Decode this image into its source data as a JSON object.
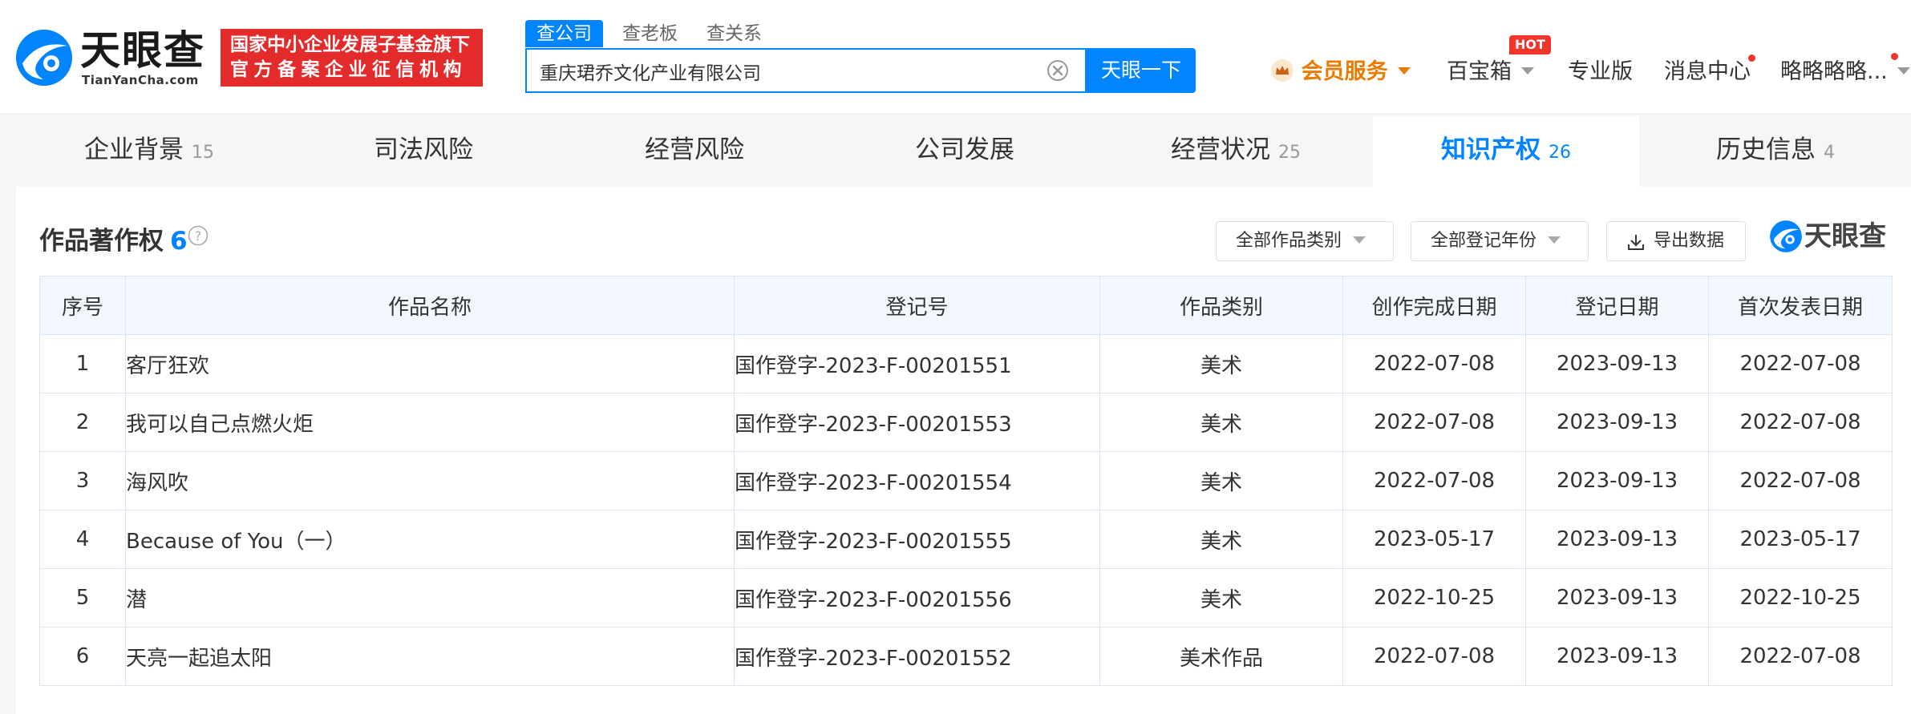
{
  "header": {
    "logo_text": "天眼查",
    "logo_sub": "TianYanCha.com",
    "fund_badge_line1": "国家中小企业发展子基金旗下",
    "fund_badge_line2": "官方备案企业征信机构",
    "search_tabs": [
      "查公司",
      "查老板",
      "查关系"
    ],
    "search_value": "重庆珺乔文化产业有限公司",
    "search_button": "天眼一下",
    "nav": {
      "vip": "会员服务",
      "treasure": "百宝箱",
      "hot_badge": "HOT",
      "pro": "专业版",
      "messages": "消息中心",
      "user": "略略略略..."
    }
  },
  "tabs": [
    {
      "label": "企业背景",
      "count": "15"
    },
    {
      "label": "司法风险",
      "count": ""
    },
    {
      "label": "经营风险",
      "count": ""
    },
    {
      "label": "公司发展",
      "count": ""
    },
    {
      "label": "经营状况",
      "count": "25"
    },
    {
      "label": "知识产权",
      "count": "26"
    },
    {
      "label": "历史信息",
      "count": "4"
    }
  ],
  "section": {
    "title": "作品著作权",
    "count": "6",
    "filters": [
      "全部作品类别",
      "全部登记年份"
    ],
    "export": "导出数据",
    "watermark_text": "天眼查"
  },
  "table": {
    "headers": [
      "序号",
      "作品名称",
      "登记号",
      "作品类别",
      "创作完成日期",
      "登记日期",
      "首次发表日期"
    ],
    "rows": [
      [
        "1",
        "客厅狂欢",
        "国作登字-2023-F-00201551",
        "美术",
        "2022-07-08",
        "2023-09-13",
        "2022-07-08"
      ],
      [
        "2",
        "我可以自己点燃火炬",
        "国作登字-2023-F-00201553",
        "美术",
        "2022-07-08",
        "2023-09-13",
        "2022-07-08"
      ],
      [
        "3",
        "海风吹",
        "国作登字-2023-F-00201554",
        "美术",
        "2022-07-08",
        "2023-09-13",
        "2022-07-08"
      ],
      [
        "4",
        "Because of You（一）",
        "国作登字-2023-F-00201555",
        "美术",
        "2023-05-17",
        "2023-09-13",
        "2023-05-17"
      ],
      [
        "5",
        "潜",
        "国作登字-2023-F-00201556",
        "美术",
        "2022-10-25",
        "2023-09-13",
        "2022-10-25"
      ],
      [
        "6",
        "天亮一起追太阳",
        "国作登字-2023-F-00201552",
        "美术作品",
        "2022-07-08",
        "2023-09-13",
        "2022-07-08"
      ]
    ]
  },
  "colors": {
    "brand_blue": "#0084ff",
    "badge_red": "#e32b2b",
    "vip_orange": "#e97b00",
    "table_header_bg": "#f2f7fd"
  },
  "icons": [
    "tianyancha-logo-icon",
    "clear-icon",
    "crown-icon",
    "help-icon",
    "download-icon"
  ]
}
